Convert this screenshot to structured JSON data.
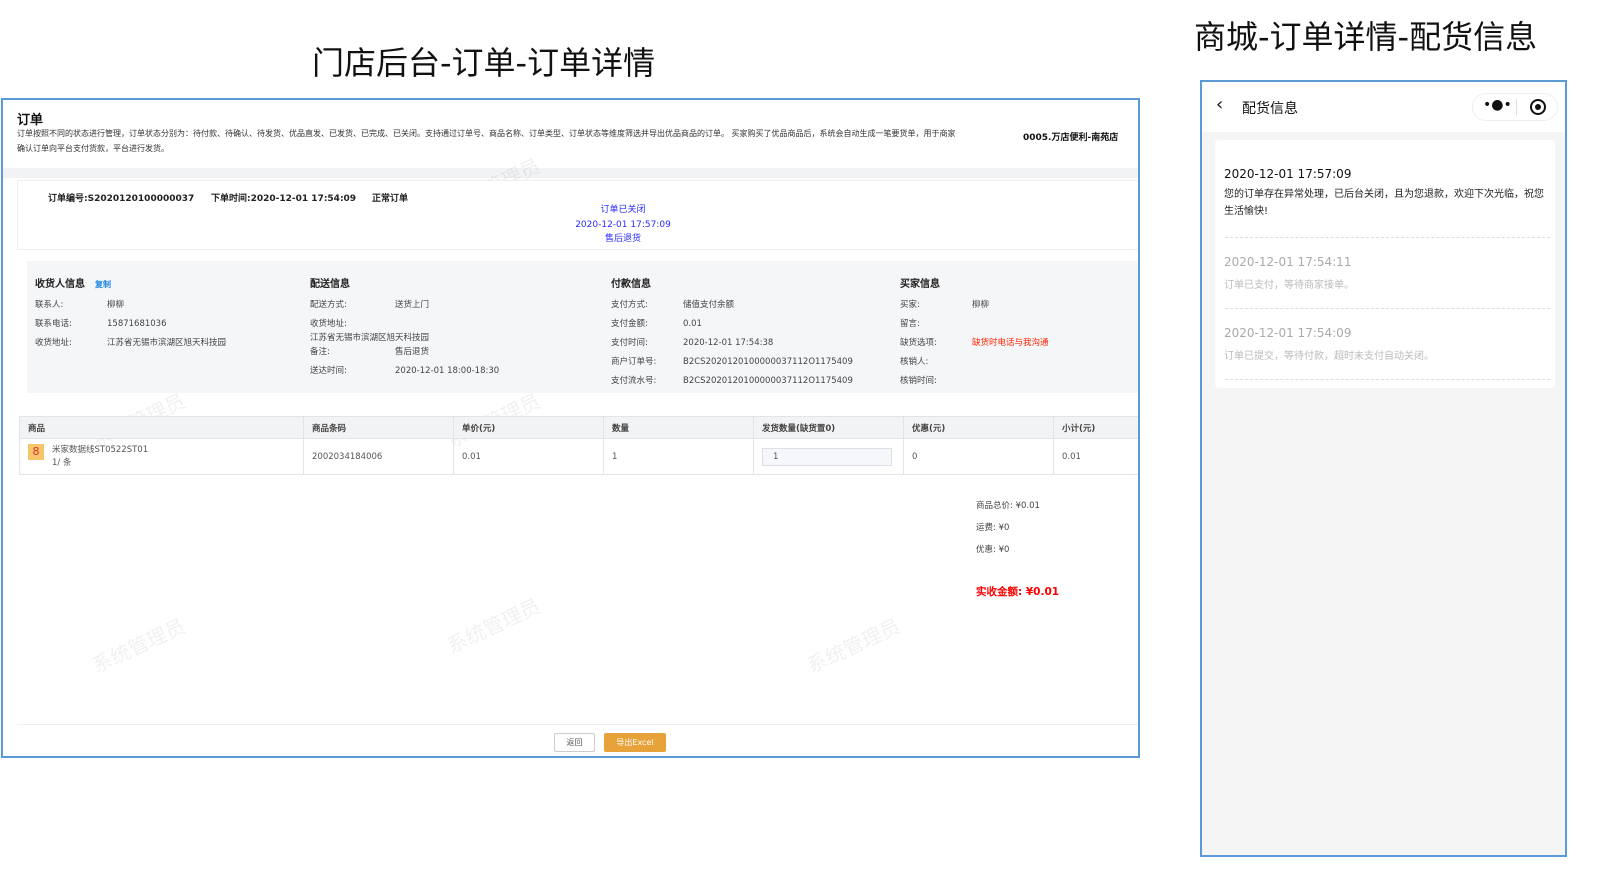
{
  "titles": {
    "admin": "门店后台-订单-订单详情",
    "mall": "商城-订单详情-配货信息"
  },
  "admin": {
    "page_title": "订单",
    "description": "订单按照不同的状态进行管理，订单状态分别为：待付款、待确认、待发货、优品直发、已发货、已完成、已关闭。支持通过订单号、商品名称、订单类型、订单状态等维度筛选并导出优品商品的订单。 买家购买了优品商品后，系统会自动生成一笔要货单，用于商家确认订单向平台支付货款，平台进行发货。",
    "store": "0005.万店便利-南苑店",
    "order_no": "订单编号:S2020120100000037",
    "order_time": "下单时间:2020-12-01 17:54:09",
    "order_type": "正常订单",
    "status": {
      "label": "订单已关闭",
      "time": "2020-12-01 17:57:09",
      "reason": "售后退货"
    },
    "watermark": "系统管理员",
    "receiver": {
      "title": "收货人信息",
      "copy": "复制",
      "rows": [
        [
          "联系人:",
          "柳柳"
        ],
        [
          "联系电话:",
          "15871681036"
        ],
        [
          "收货地址:",
          "江苏省无锡市滨湖区旭天科技园"
        ]
      ]
    },
    "delivery": {
      "title": "配送信息",
      "method_label": "配送方式:",
      "method": "送货上门",
      "addr_label": "收货地址:",
      "addr": "江苏省无锡市滨湖区旭天科技园",
      "note_label": "备注:",
      "note": "售后退货",
      "time_label": "送达时间:",
      "time": "2020-12-01 18:00-18:30"
    },
    "payment": {
      "title": "付款信息",
      "rows": [
        [
          "支付方式:",
          "储值支付余额"
        ],
        [
          "支付金额:",
          "0.01"
        ],
        [
          "支付时间:",
          "2020-12-01 17:54:38"
        ],
        [
          "商户订单号:",
          "B2CS2020120100000037112O1175409"
        ],
        [
          "支付流水号:",
          "B2CS2020120100000037112O1175409"
        ]
      ]
    },
    "buyer": {
      "title": "买家信息",
      "rows": [
        [
          "买家:",
          "柳柳"
        ],
        [
          "留言:",
          ""
        ],
        [
          "缺货选项:",
          "缺货时电话与我沟通"
        ],
        [
          "核销人:",
          ""
        ],
        [
          "核销时间:",
          ""
        ]
      ]
    },
    "table": {
      "headers": [
        "商品",
        "商品条码",
        "单价(元)",
        "数量",
        "发货数量(缺货置0)",
        "优惠(元)",
        "小计(元)"
      ],
      "row": {
        "name": "米家数据线ST0522ST01",
        "unit": "1/ 条",
        "barcode": "2002034184006",
        "price": "0.01",
        "qty": "1",
        "ship_qty": "1",
        "discount": "0",
        "subtotal": "0.01"
      }
    },
    "summary": {
      "goods_total": "商品总价: ¥0.01",
      "freight": "运费: ¥0",
      "discount": "优惠: ¥0",
      "actual": "实收金额: ¥0.01"
    },
    "buttons": {
      "back": "返回",
      "export": "导出Excel"
    },
    "colors": {
      "accent": "#e8a23a",
      "link": "#1e88e5",
      "status": "#2b2bff",
      "border": "#5b9bd5"
    }
  },
  "mall": {
    "nav_title": "配货信息",
    "logs": [
      {
        "time": "2020-12-01 17:57:09",
        "text": "您的订单存在异常处理，已后台关闭，且为您退款，欢迎下次光临，祝您生活愉快!"
      },
      {
        "time": "2020-12-01 17:54:11",
        "text": "订单已支付，等待商家接单。"
      },
      {
        "time": "2020-12-01 17:54:09",
        "text": "订单已提交，等待付款，超时未支付自动关闭。"
      }
    ]
  }
}
